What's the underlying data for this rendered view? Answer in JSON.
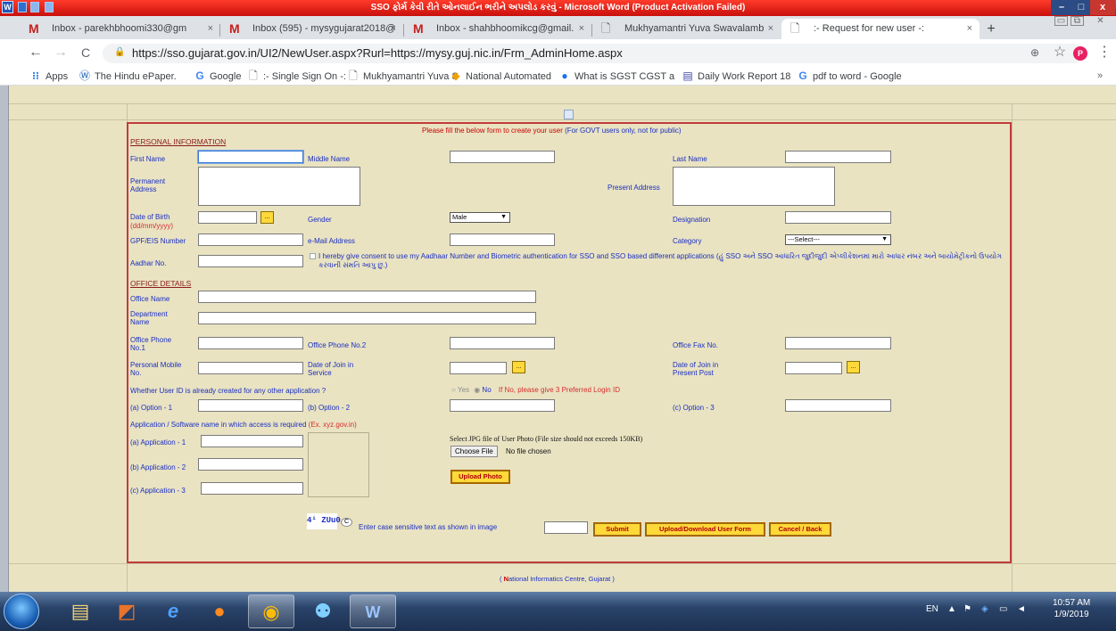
{
  "word": {
    "title": "SSO ફોર્મ કેવી રીતે ઓનલાઈન ભરીને અપલોડ કરવું - Microsoft Word (Product Activation Failed)",
    "logo": "W",
    "min": "–",
    "max": "□",
    "close": "x",
    "submin": "▭",
    "submax": "⧉",
    "subclose": "✕"
  },
  "browser": {
    "tabs": [
      {
        "label": "Inbox - parekhbhoomi330@gm",
        "icon": "gmail-icon"
      },
      {
        "label": "Inbox (595) - mysygujarat2018@",
        "icon": "gmail-icon"
      },
      {
        "label": "Inbox - shahbhoomikcg@gmail.",
        "icon": "gmail-icon"
      },
      {
        "label": "Mukhyamantri Yuva Swavalamb",
        "icon": "doc-icon"
      },
      {
        "label": ":- Request for new user -:",
        "icon": "doc-icon"
      }
    ],
    "new_tab": "+",
    "tab_close": "×",
    "url": "https://sso.gujarat.gov.in/UI2/NewUser.aspx?Rurl=https://mysy.guj.nic.in/Frm_AdminHome.aspx",
    "nav": {
      "back": "←",
      "forward": "→",
      "reload": "C",
      "lock": "🔒",
      "zoom": "⊕",
      "star": "☆",
      "profile": "P",
      "menu": "⋮"
    },
    "bookmarks": [
      {
        "label": "Apps",
        "icon": "apps-icon"
      },
      {
        "label": "The Hindu ePaper.",
        "icon": "hindu-icon"
      },
      {
        "label": "Google",
        "icon": "google-icon"
      },
      {
        "label": ":- Single Sign On -:",
        "icon": "doc-icon"
      },
      {
        "label": "Mukhyamantri Yuva S",
        "icon": "doc-icon"
      },
      {
        "label": "National Automated",
        "icon": "nad-icon"
      },
      {
        "label": "What is SGST CGST a",
        "icon": "people-icon"
      },
      {
        "label": "Daily Work Report 18",
        "icon": "sheets-icon"
      },
      {
        "label": "pdf to word - Google",
        "icon": "google-icon"
      }
    ],
    "more": "»"
  },
  "form": {
    "intro": "Please fill the below form to create your user",
    "intro_note": "(For GOVT users only, not for public)",
    "personal_heading": "PERSONAL INFORMATION",
    "first_name": "First Name",
    "middle_name": "Middle Name",
    "last_name": "Last Name",
    "permanent_address": "Permanent Address",
    "present_address": "Present Address",
    "dob": "Date of Birth",
    "dob_fmt": "(dd/mm/yyyy)",
    "gender": "Gender",
    "gender_value": "Male",
    "designation": "Designation",
    "gpf": "GPF/EIS Number",
    "email": "e-Mail Address",
    "category": "Category",
    "category_value": "---Select---",
    "aadhar": "Aadhar No.",
    "consent": "I hereby give consent to use my Aadhaar Number and Biometric authentication for SSO and SSO based different applications (હું SSO અને SSO આધારિત જુદીજુદી એપ્લીકેશનમાં મારો આધાર નંબર અને બાયોમેટ્રીકનો ઉપયોગ કરવાની સંમતિ આપુ છુ.)",
    "office_heading": "OFFICE DETAILS",
    "office_name": "Office Name",
    "department_name": "Department Name",
    "office_phone1": "Office Phone No.1",
    "office_phone2": "Office Phone No.2",
    "office_fax": "Office Fax No.",
    "mobile": "Personal Mobile No.",
    "doj_service": "Date of Join in Service",
    "doj_post": "Date of Join in Present Post",
    "cal_btn": "...",
    "userid_q": "Whether User ID is already created for any other application ?",
    "yes": "Yes",
    "no": "No",
    "userid_note": "If No, please give 3 Preferred Login ID",
    "opt1": "(a) Option - 1",
    "opt2": "(b) Option - 2",
    "opt3": "(c) Option - 3",
    "app_q": "Application / Software name in which access is required",
    "app_ex": "(Ex. xyz.gov.in)",
    "app1": "(a) Application - 1",
    "app2": "(b) Application - 2",
    "app3": "(c) Application - 3",
    "photo_label": "Select JPG file of User Photo (File size should not exceeds 150KB)",
    "choose_file": "Choose File",
    "no_file": "No file chosen",
    "upload_photo": "Upload Photo",
    "captcha_text": "4ⁱ ZUu0",
    "refresh": "C",
    "captcha_prompt": "Enter case sensitive text as shown in image",
    "submit": "Submit",
    "upload_form": "Upload/Download User Form",
    "cancel": "Cancel / Back"
  },
  "footer": {
    "text_pre": "( ",
    "text_n": "N",
    "text_rest": "ational Informatics Centre, Gujarat )"
  },
  "taskbar": {
    "lang": "EN",
    "time": "10:57 AM",
    "date": "1/9/2019"
  }
}
